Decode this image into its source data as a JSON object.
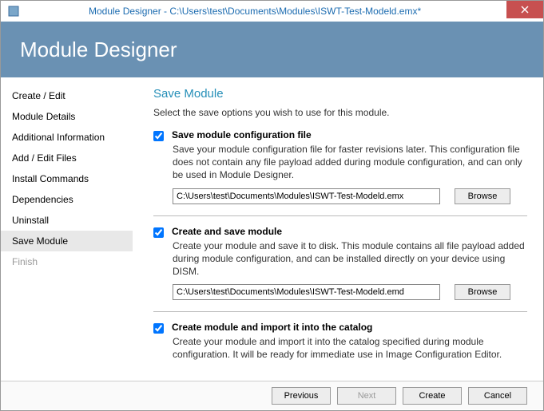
{
  "titlebar": {
    "app_name": "Module Designer",
    "full_title": "Module Designer - C:\\Users\\test\\Documents\\Modules\\ISWT-Test-Modeld.emx*"
  },
  "header": {
    "title": "Module Designer"
  },
  "sidebar": {
    "items": [
      {
        "label": "Create / Edit",
        "selected": false,
        "faded": false
      },
      {
        "label": "Module Details",
        "selected": false,
        "faded": false
      },
      {
        "label": "Additional Information",
        "selected": false,
        "faded": false
      },
      {
        "label": "Add / Edit Files",
        "selected": false,
        "faded": false
      },
      {
        "label": "Install Commands",
        "selected": false,
        "faded": false
      },
      {
        "label": "Dependencies",
        "selected": false,
        "faded": false
      },
      {
        "label": "Uninstall",
        "selected": false,
        "faded": false
      },
      {
        "label": "Save Module",
        "selected": true,
        "faded": false
      },
      {
        "label": "Finish",
        "selected": false,
        "faded": true
      }
    ]
  },
  "content": {
    "title": "Save Module",
    "subtitle": "Select the save options you wish to use for this module.",
    "options": [
      {
        "label": "Save module configuration file",
        "desc": "Save your module configuration file for faster revisions later. This configuration file does not contain any file payload added during module configuration, and can only be used in Module Designer.",
        "path": "C:\\Users\\test\\Documents\\Modules\\ISWT-Test-Modeld.emx",
        "browse": "Browse",
        "checked": true,
        "hasPath": true
      },
      {
        "label": "Create and save module",
        "desc": "Create your module and save it to disk. This module contains all file payload added during module configuration, and can be installed directly on your device using DISM.",
        "path": "C:\\Users\\test\\Documents\\Modules\\ISWT-Test-Modeld.emd",
        "browse": "Browse",
        "checked": true,
        "hasPath": true
      },
      {
        "label": "Create module and import it into the catalog",
        "desc": "Create your module and import it into the catalog specified during module configuration. It will be ready for immediate use in Image Configuration Editor.",
        "checked": true,
        "hasPath": false
      }
    ]
  },
  "footer": {
    "previous": "Previous",
    "next": "Next",
    "create": "Create",
    "cancel": "Cancel",
    "next_enabled": false
  }
}
